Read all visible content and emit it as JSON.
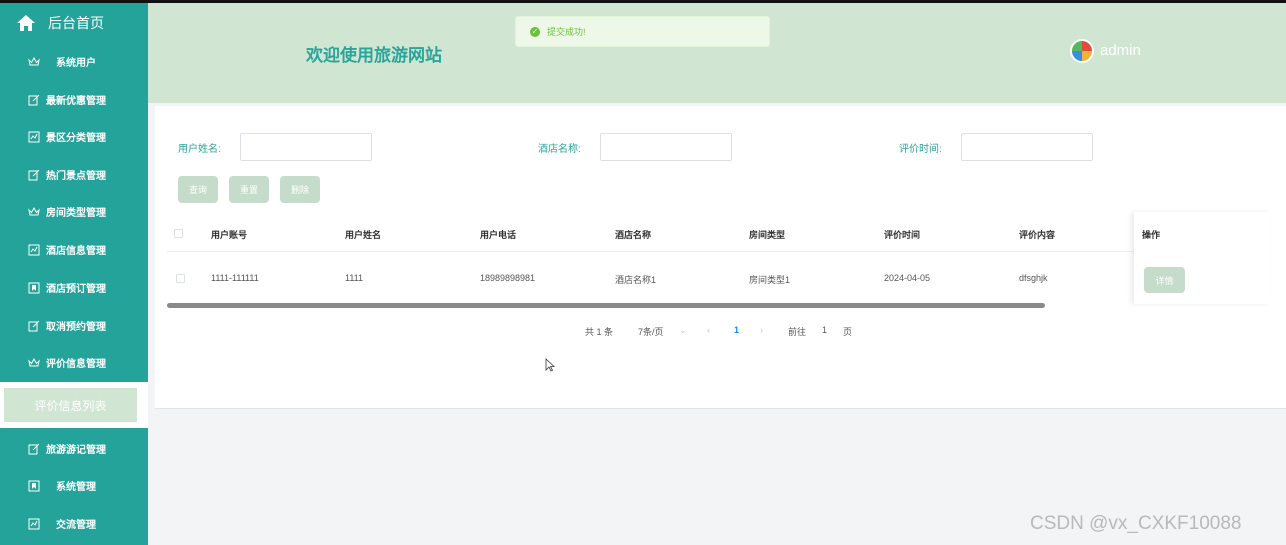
{
  "sidebar": {
    "home_label": "后台首页",
    "items": [
      {
        "label": "系统用户",
        "icon": "crown-icon"
      },
      {
        "label": "最新优惠管理",
        "icon": "edit-icon"
      },
      {
        "label": "景区分类管理",
        "icon": "chart-icon"
      },
      {
        "label": "热门景点管理",
        "icon": "edit-icon"
      },
      {
        "label": "房间类型管理",
        "icon": "crown-icon"
      },
      {
        "label": "酒店信息管理",
        "icon": "chart-icon"
      },
      {
        "label": "酒店预订管理",
        "icon": "bookmark-icon"
      },
      {
        "label": "取消预约管理",
        "icon": "edit-icon"
      },
      {
        "label": "评价信息管理",
        "icon": "crown-icon"
      }
    ],
    "active_sub": "评价信息列表",
    "items_after": [
      {
        "label": "旅游游记管理",
        "icon": "edit-icon"
      },
      {
        "label": "系统管理",
        "icon": "bookmark-icon"
      },
      {
        "label": "交流管理",
        "icon": "chart-icon"
      }
    ]
  },
  "header": {
    "title": "欢迎使用旅游网站",
    "user": "admin"
  },
  "toast": {
    "message": "提交成功!"
  },
  "search": {
    "fields": [
      {
        "label": "用户姓名:",
        "value": ""
      },
      {
        "label": "酒店名称:",
        "value": ""
      },
      {
        "label": "评价时间:",
        "value": ""
      }
    ],
    "buttons": {
      "query": "查询",
      "reset": "重置",
      "delete": "删除"
    }
  },
  "table": {
    "columns": [
      "用户账号",
      "用户姓名",
      "用户电话",
      "酒店名称",
      "房间类型",
      "评价时间",
      "评价内容",
      "操作"
    ],
    "rows": [
      {
        "account": "1111-111111",
        "name": "1111",
        "phone": "18989898981",
        "hotel": "酒店名称1",
        "room": "房间类型1",
        "time": "2024-04-05",
        "content": "dfsghjk",
        "action": "详情"
      }
    ]
  },
  "pagination": {
    "total": "共 1 条",
    "page_size": "7条/页",
    "current_page": "1",
    "goto_prefix": "前往",
    "goto_value": "1",
    "goto_suffix": "页"
  },
  "watermark": "CSDN @vx_CXKF10088",
  "colors": {
    "sidebar": "#24a39a",
    "header": "#d1e5d3",
    "accent": "#2aa59a",
    "button": "#c6dccb",
    "success": "#67c23a"
  }
}
